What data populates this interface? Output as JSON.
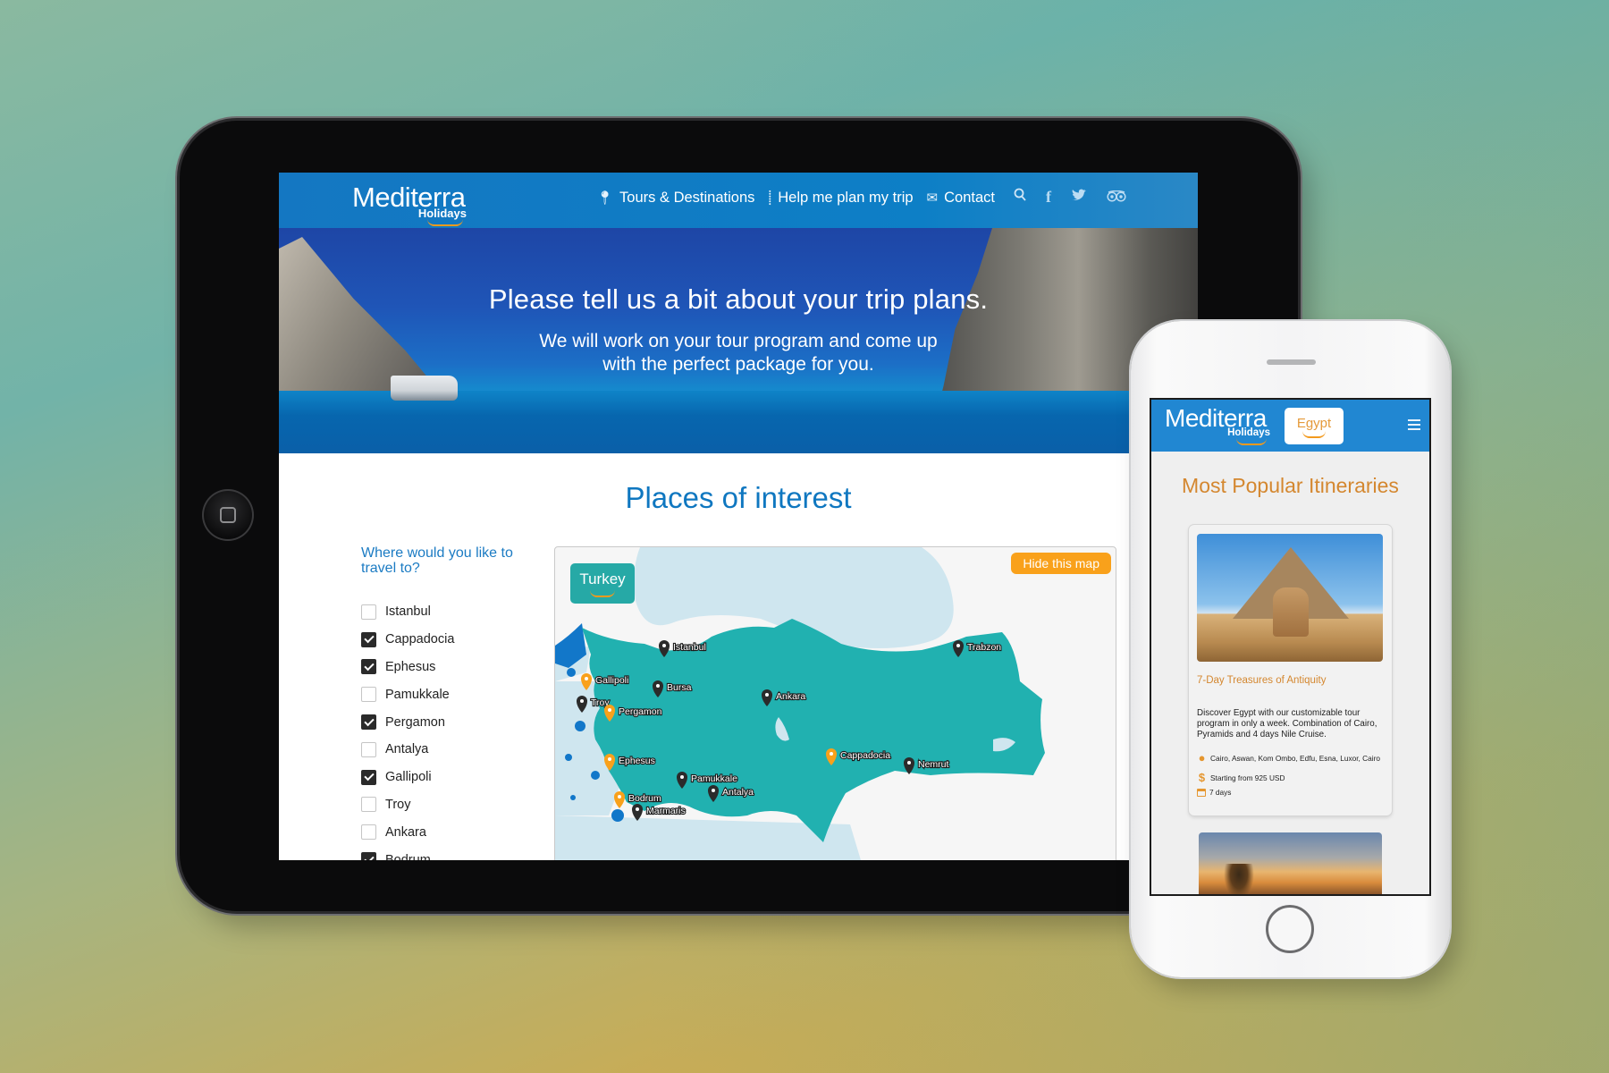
{
  "tablet": {
    "header": {
      "logo_main": "Mediterra",
      "logo_sub": "Holidays",
      "nav": [
        {
          "icon": "map-pin-icon",
          "label": "Tours & Destinations"
        },
        {
          "icon": "route-icon",
          "label": "Help me plan my trip"
        },
        {
          "icon": "envelope-icon",
          "label": "Contact"
        }
      ],
      "social_icons": [
        "search-icon",
        "facebook-icon",
        "twitter-icon",
        "tripadvisor-icon"
      ]
    },
    "hero": {
      "title": "Please tell us a bit about your trip plans.",
      "subtitle_line1": "We will work on your tour program and come up",
      "subtitle_line2": "with the perfect package for you."
    },
    "places": {
      "title": "Places of interest",
      "question": "Where would you like to travel to?",
      "options": [
        {
          "label": "Istanbul",
          "checked": false
        },
        {
          "label": "Cappadocia",
          "checked": true
        },
        {
          "label": "Ephesus",
          "checked": true
        },
        {
          "label": "Pamukkale",
          "checked": false
        },
        {
          "label": "Pergamon",
          "checked": true
        },
        {
          "label": "Antalya",
          "checked": false
        },
        {
          "label": "Gallipoli",
          "checked": true
        },
        {
          "label": "Troy",
          "checked": false
        },
        {
          "label": "Ankara",
          "checked": false
        },
        {
          "label": "Bodrum",
          "checked": true
        }
      ]
    },
    "map": {
      "country_label": "Turkey",
      "hide_button": "Hide this map",
      "colors": {
        "land": "#21b1b0",
        "sea": "#cfe6ef",
        "selected_pin": "#f9a11b",
        "pin": "#2b2b2b"
      },
      "markers": [
        {
          "name": "Istanbul",
          "selected": false
        },
        {
          "name": "Trabzon",
          "selected": false
        },
        {
          "name": "Gallipoli",
          "selected": true
        },
        {
          "name": "Bursa",
          "selected": false
        },
        {
          "name": "Ankara",
          "selected": false
        },
        {
          "name": "Troy",
          "selected": false
        },
        {
          "name": "Pergamon",
          "selected": true
        },
        {
          "name": "Ephesus",
          "selected": true
        },
        {
          "name": "Pamukkale",
          "selected": false
        },
        {
          "name": "Cappadocia",
          "selected": true
        },
        {
          "name": "Nemrut",
          "selected": false
        },
        {
          "name": "Bodrum",
          "selected": true
        },
        {
          "name": "Antalya",
          "selected": false
        },
        {
          "name": "Marmaris",
          "selected": false
        }
      ]
    }
  },
  "phone": {
    "logo_main": "Mediterra",
    "logo_sub": "Holidays",
    "country_badge": "Egypt",
    "menu_icon": "hamburger-icon",
    "section_title": "Most Popular Itineraries",
    "cards": [
      {
        "title": "7-Day Treasures of Antiquity",
        "description": "Discover Egypt with our customizable tour program in only a week. Combination of Cairo, Pyramids and 4 days Nile Cruise.",
        "route": "Cairo, Aswan, Kom Ombo, Edfu, Esna, Luxor, Cairo",
        "price": "Starting from 925 USD",
        "duration": "7 days"
      }
    ]
  },
  "colors": {
    "brand_blue": "#0f77c0",
    "accent_orange": "#f9a11b",
    "phone_title": "#d4872f"
  }
}
